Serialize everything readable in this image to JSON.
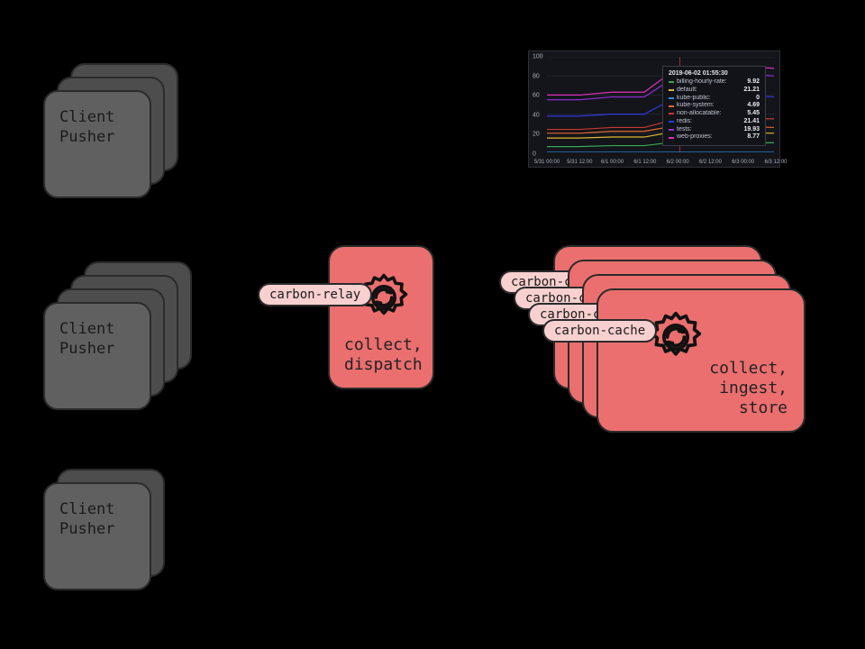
{
  "clients": {
    "label_line1": "Client",
    "label_line2": "Pusher"
  },
  "relay": {
    "tag": "carbon-relay",
    "desc_line1": "collect,",
    "desc_line2": "dispatch"
  },
  "cache": {
    "tag": "carbon-cache",
    "tag_clipped": "carbon-cac",
    "desc_line1": "collect,",
    "desc_line2": "ingest,",
    "desc_line3": "store"
  },
  "chart": {
    "yticks": [
      "0",
      "20",
      "40",
      "60",
      "80",
      "100"
    ],
    "xticks": [
      "5/31 00:00",
      "5/31 12:00",
      "6/1 00:00",
      "6/1 12:00",
      "6/2 00:00",
      "6/2 12:00",
      "6/3 00:00",
      "6/3 12:00"
    ],
    "tooltip": {
      "title": "2019-06-02 01:55:30",
      "rows": [
        {
          "name": "billing-hourly-rate:",
          "value": "9.92",
          "color": "#3aa757"
        },
        {
          "name": "default:",
          "value": "21.21",
          "color": "#e0b62f"
        },
        {
          "name": "kube-public:",
          "value": "0",
          "color": "#2f8fe0"
        },
        {
          "name": "kube-system:",
          "value": "4.69",
          "color": "#e0672f"
        },
        {
          "name": "non-allocatable:",
          "value": "5.45",
          "color": "#c43a2f"
        },
        {
          "name": "redis:",
          "value": "21.41",
          "color": "#2f3ae0"
        },
        {
          "name": "tests:",
          "value": "19.93",
          "color": "#9a2fe0"
        },
        {
          "name": "web-proxies:",
          "value": "8.77",
          "color": "#e02fbb"
        }
      ]
    }
  },
  "chart_data": {
    "type": "line",
    "title": "",
    "xlabel": "",
    "ylabel": "",
    "ylim": [
      0,
      100
    ],
    "x_tick_labels": [
      "5/31 00:00",
      "5/31 12:00",
      "6/1 00:00",
      "6/1 12:00",
      "6/2 00:00",
      "6/2 12:00",
      "6/3 00:00",
      "6/3 12:00"
    ],
    "tooltip_at": "2019-06-02 01:55:30",
    "series": [
      {
        "name": "billing-hourly-rate",
        "color": "#3aa757",
        "value_at_tooltip": 9.92,
        "approx_path": [
          6,
          6,
          7,
          7,
          11,
          10,
          10,
          10
        ]
      },
      {
        "name": "default",
        "color": "#e0b62f",
        "value_at_tooltip": 21.21,
        "approx_path": [
          15,
          15,
          16,
          16,
          22,
          21,
          21,
          20
        ]
      },
      {
        "name": "kube-public",
        "color": "#2f8fe0",
        "value_at_tooltip": 0,
        "approx_path": [
          0,
          0,
          0,
          0,
          0,
          0,
          0,
          0
        ]
      },
      {
        "name": "kube-system",
        "color": "#e0672f",
        "value_at_tooltip": 4.69,
        "approx_path": [
          20,
          20,
          22,
          22,
          28,
          28,
          27,
          26
        ]
      },
      {
        "name": "non-allocatable",
        "color": "#c43a2f",
        "value_at_tooltip": 5.45,
        "approx_path": [
          24,
          24,
          26,
          26,
          35,
          36,
          36,
          35
        ]
      },
      {
        "name": "redis",
        "color": "#2f3ae0",
        "value_at_tooltip": 21.41,
        "approx_path": [
          38,
          38,
          40,
          40,
          58,
          60,
          60,
          58
        ]
      },
      {
        "name": "tests",
        "color": "#9a2fe0",
        "value_at_tooltip": 19.93,
        "approx_path": [
          55,
          55,
          58,
          58,
          80,
          82,
          82,
          80
        ]
      },
      {
        "name": "web-proxies",
        "color": "#e02fbb",
        "value_at_tooltip": 8.77,
        "approx_path": [
          60,
          60,
          63,
          63,
          88,
          90,
          90,
          88
        ]
      }
    ]
  }
}
